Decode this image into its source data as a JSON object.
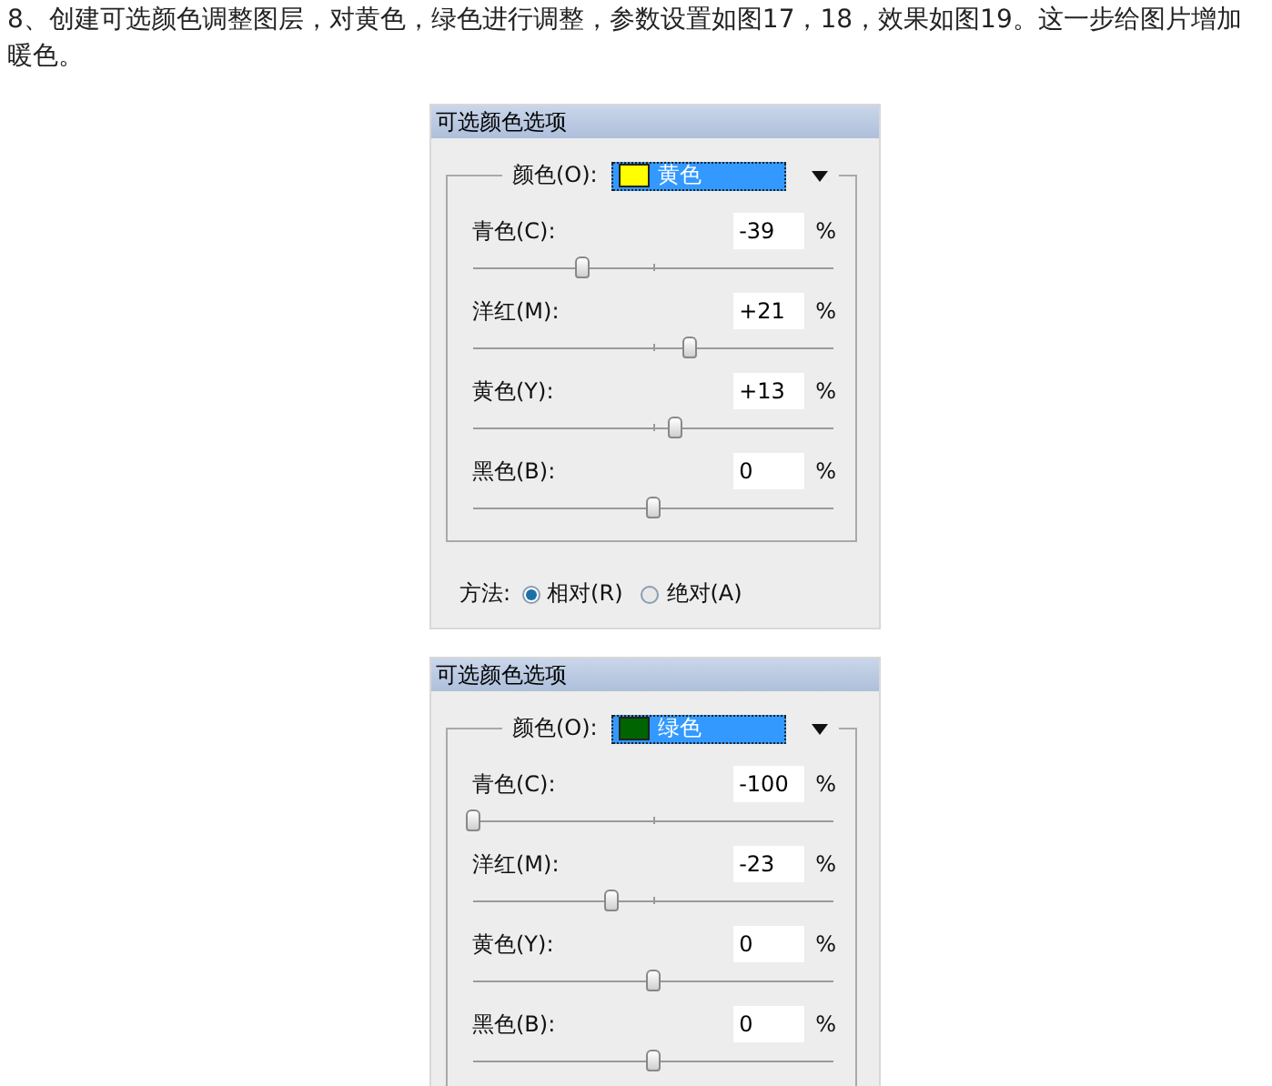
{
  "intro": "8、创建可选颜色调整图层，对黄色，绿色进行调整，参数设置如图17，18，效果如图19。这一步给图片增加暖色。",
  "panels": [
    {
      "title": "可选颜色选项",
      "color_label": "颜色(O):",
      "color_choice": {
        "name": "黄色",
        "color": "#ffff00"
      },
      "sliders": [
        {
          "label": "青色(C):",
          "value": "-39",
          "unit": "%",
          "level": 0.305
        },
        {
          "label": "洋红(M):",
          "value": "+21",
          "unit": "%",
          "level": 0.605
        },
        {
          "label": "黄色(Y):",
          "value": "+13",
          "unit": "%",
          "level": 0.565
        },
        {
          "label": "黑色(B):",
          "value": "0",
          "unit": "%",
          "level": 0.5
        }
      ],
      "method": {
        "label": "方法:",
        "options": [
          {
            "label": "相对(R)",
            "selected": true
          },
          {
            "label": "绝对(A)",
            "selected": false
          }
        ]
      }
    },
    {
      "title": "可选颜色选项",
      "color_label": "颜色(O):",
      "color_choice": {
        "name": "绿色",
        "color": "#006400"
      },
      "sliders": [
        {
          "label": "青色(C):",
          "value": "-100",
          "unit": "%",
          "level": 0
        },
        {
          "label": "洋红(M):",
          "value": "-23",
          "unit": "%",
          "level": 0.385
        },
        {
          "label": "黄色(Y):",
          "value": "0",
          "unit": "%",
          "level": 0.5
        },
        {
          "label": "黑色(B):",
          "value": "0",
          "unit": "%",
          "level": 0.5
        }
      ]
    }
  ]
}
